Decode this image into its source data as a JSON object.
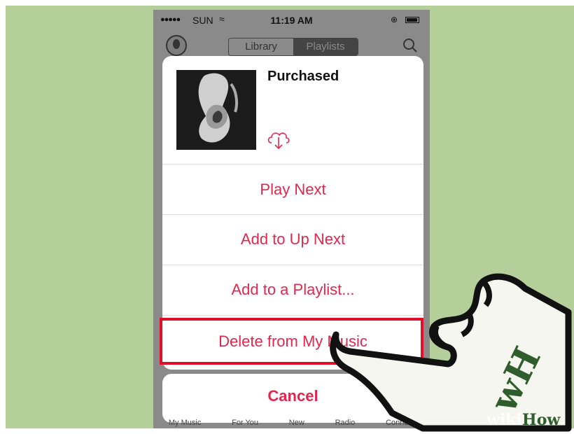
{
  "status_bar": {
    "signal": "●●●●●",
    "carrier": "SUN",
    "wifi": "≈",
    "time": "11:19 AM"
  },
  "nav": {
    "tabs": [
      "Library",
      "Playlists"
    ],
    "selected_tab": "Playlists"
  },
  "sheet": {
    "title": "Purchased",
    "actions": [
      "Play Next",
      "Add to Up Next",
      "Add to a Playlist...",
      "Delete from My Music"
    ],
    "cancel_label": "Cancel",
    "accent": "#e0284f"
  },
  "tab_bar": [
    "My Music",
    "For You",
    "New",
    "Radio",
    "Connect"
  ],
  "watermark": {
    "wiki": "wiki",
    "how": "How",
    "hand_letters": "wH"
  },
  "colors": {
    "background": "#b5cf9b",
    "highlight": "#e0102a"
  }
}
